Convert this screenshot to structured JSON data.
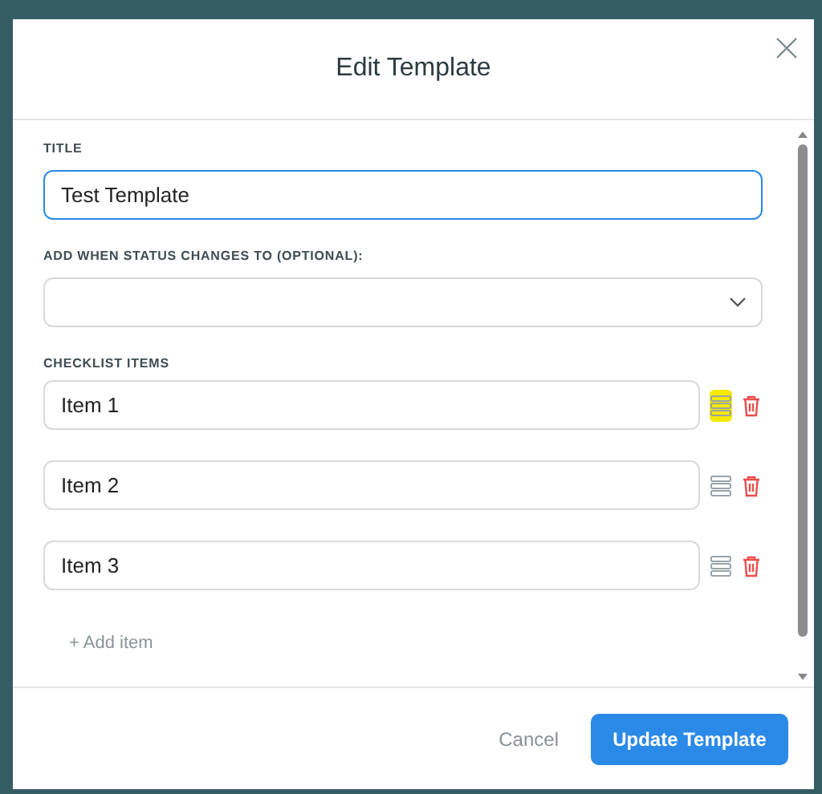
{
  "dialog": {
    "title": "Edit Template"
  },
  "title_field": {
    "label": "TITLE",
    "value": "Test Template",
    "focused": true
  },
  "status_field": {
    "label": "ADD WHEN STATUS CHANGES TO (OPTIONAL):"
  },
  "checklist": {
    "label": "CHECKLIST ITEMS",
    "items": [
      {
        "value": "Item 1",
        "highlighted": true
      },
      {
        "value": "Item 2",
        "highlighted": false
      },
      {
        "value": "Item 3",
        "highlighted": false
      }
    ],
    "add_label": "+ Add item"
  },
  "buttons": {
    "cancel": "Cancel",
    "submit": "Update Template"
  }
}
